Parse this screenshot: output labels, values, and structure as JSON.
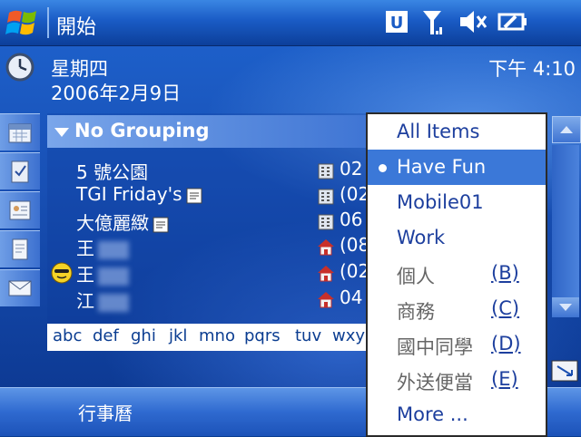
{
  "titlebar": {
    "title": "開始"
  },
  "today": {
    "day": "星期四",
    "date": "2006年2月9日",
    "time": "下午 4:10"
  },
  "contacts": {
    "group": "No Grouping",
    "rows": [
      {
        "name": "5 號公園",
        "phone": "02"
      },
      {
        "name": "TGI Friday's",
        "phone": "(02"
      },
      {
        "name": "大億麗緻",
        "phone": "06"
      },
      {
        "name": "王",
        "phone": "(08"
      },
      {
        "name": "王",
        "phone": "(02"
      },
      {
        "name": "江",
        "phone": "04"
      }
    ],
    "alphabet": [
      "abc",
      "def",
      "ghi",
      "jkl",
      "mno",
      "pqrs",
      "tuv",
      "wxy"
    ]
  },
  "menu": {
    "items": [
      {
        "label": "All Items",
        "key": ""
      },
      {
        "label": "Have Fun",
        "key": ""
      },
      {
        "label": "Mobile01",
        "key": ""
      },
      {
        "label": "Work",
        "key": ""
      },
      {
        "label": "個人",
        "key": "(B)"
      },
      {
        "label": "商務",
        "key": "(C)"
      },
      {
        "label": "國中同學",
        "key": "(D)"
      },
      {
        "label": "外送便當",
        "key": "(E)"
      },
      {
        "label": "More ...",
        "key": ""
      }
    ],
    "selected": "Have Fun"
  },
  "softkeys": {
    "left": "行事曆"
  },
  "colors": {
    "accent": "#3b78d8",
    "menu_text": "#1d3f9e",
    "titlebar": "#1a5bc5"
  }
}
